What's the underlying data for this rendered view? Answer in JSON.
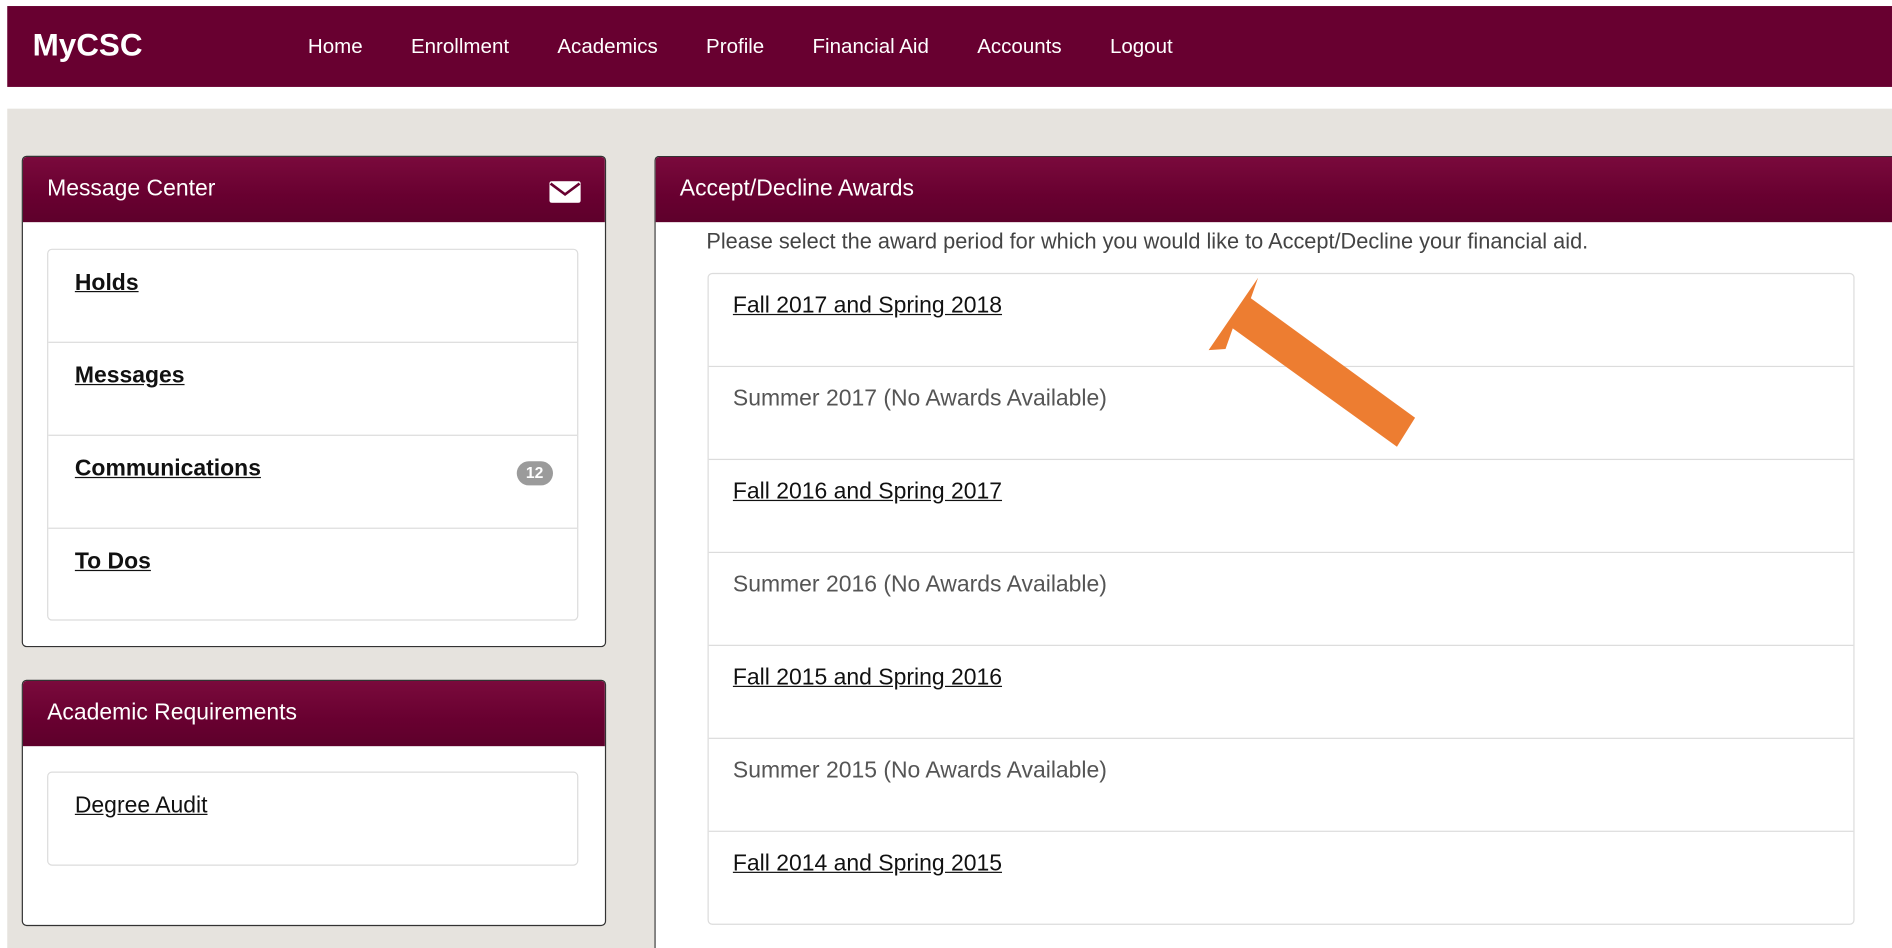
{
  "app": {
    "brand": "MyCSC"
  },
  "nav": {
    "items": [
      {
        "label": "Home"
      },
      {
        "label": "Enrollment"
      },
      {
        "label": "Academics"
      },
      {
        "label": "Profile"
      },
      {
        "label": "Financial Aid"
      },
      {
        "label": "Accounts"
      },
      {
        "label": "Logout"
      }
    ]
  },
  "message_center": {
    "title": "Message Center",
    "icon": "envelope-icon",
    "items": [
      {
        "label": "Holds"
      },
      {
        "label": "Messages"
      },
      {
        "label": "Communications",
        "badge": "12"
      },
      {
        "label": "To Dos"
      }
    ]
  },
  "academic_requirements": {
    "title": "Academic Requirements",
    "items": [
      {
        "label": "Degree Audit"
      }
    ]
  },
  "awards": {
    "title": "Accept/Decline Awards",
    "instruction": "Please select the award period for which you would like to Accept/Decline your financial aid.",
    "periods": [
      {
        "label": "Fall 2017 and Spring 2018"
      },
      {
        "label": "Summer 2017 (No Awards Available)"
      },
      {
        "label": "Fall 2016 and Spring 2017"
      },
      {
        "label": "Summer 2016 (No Awards Available)"
      },
      {
        "label": "Fall 2015 and Spring 2016"
      },
      {
        "label": "Summer 2015 (No Awards Available)"
      },
      {
        "label": "Fall 2014 and Spring 2015"
      }
    ]
  },
  "colors": {
    "brand": "#680030",
    "content_bg": "#e6e3de",
    "annotation_arrow": "#ed7d31"
  }
}
